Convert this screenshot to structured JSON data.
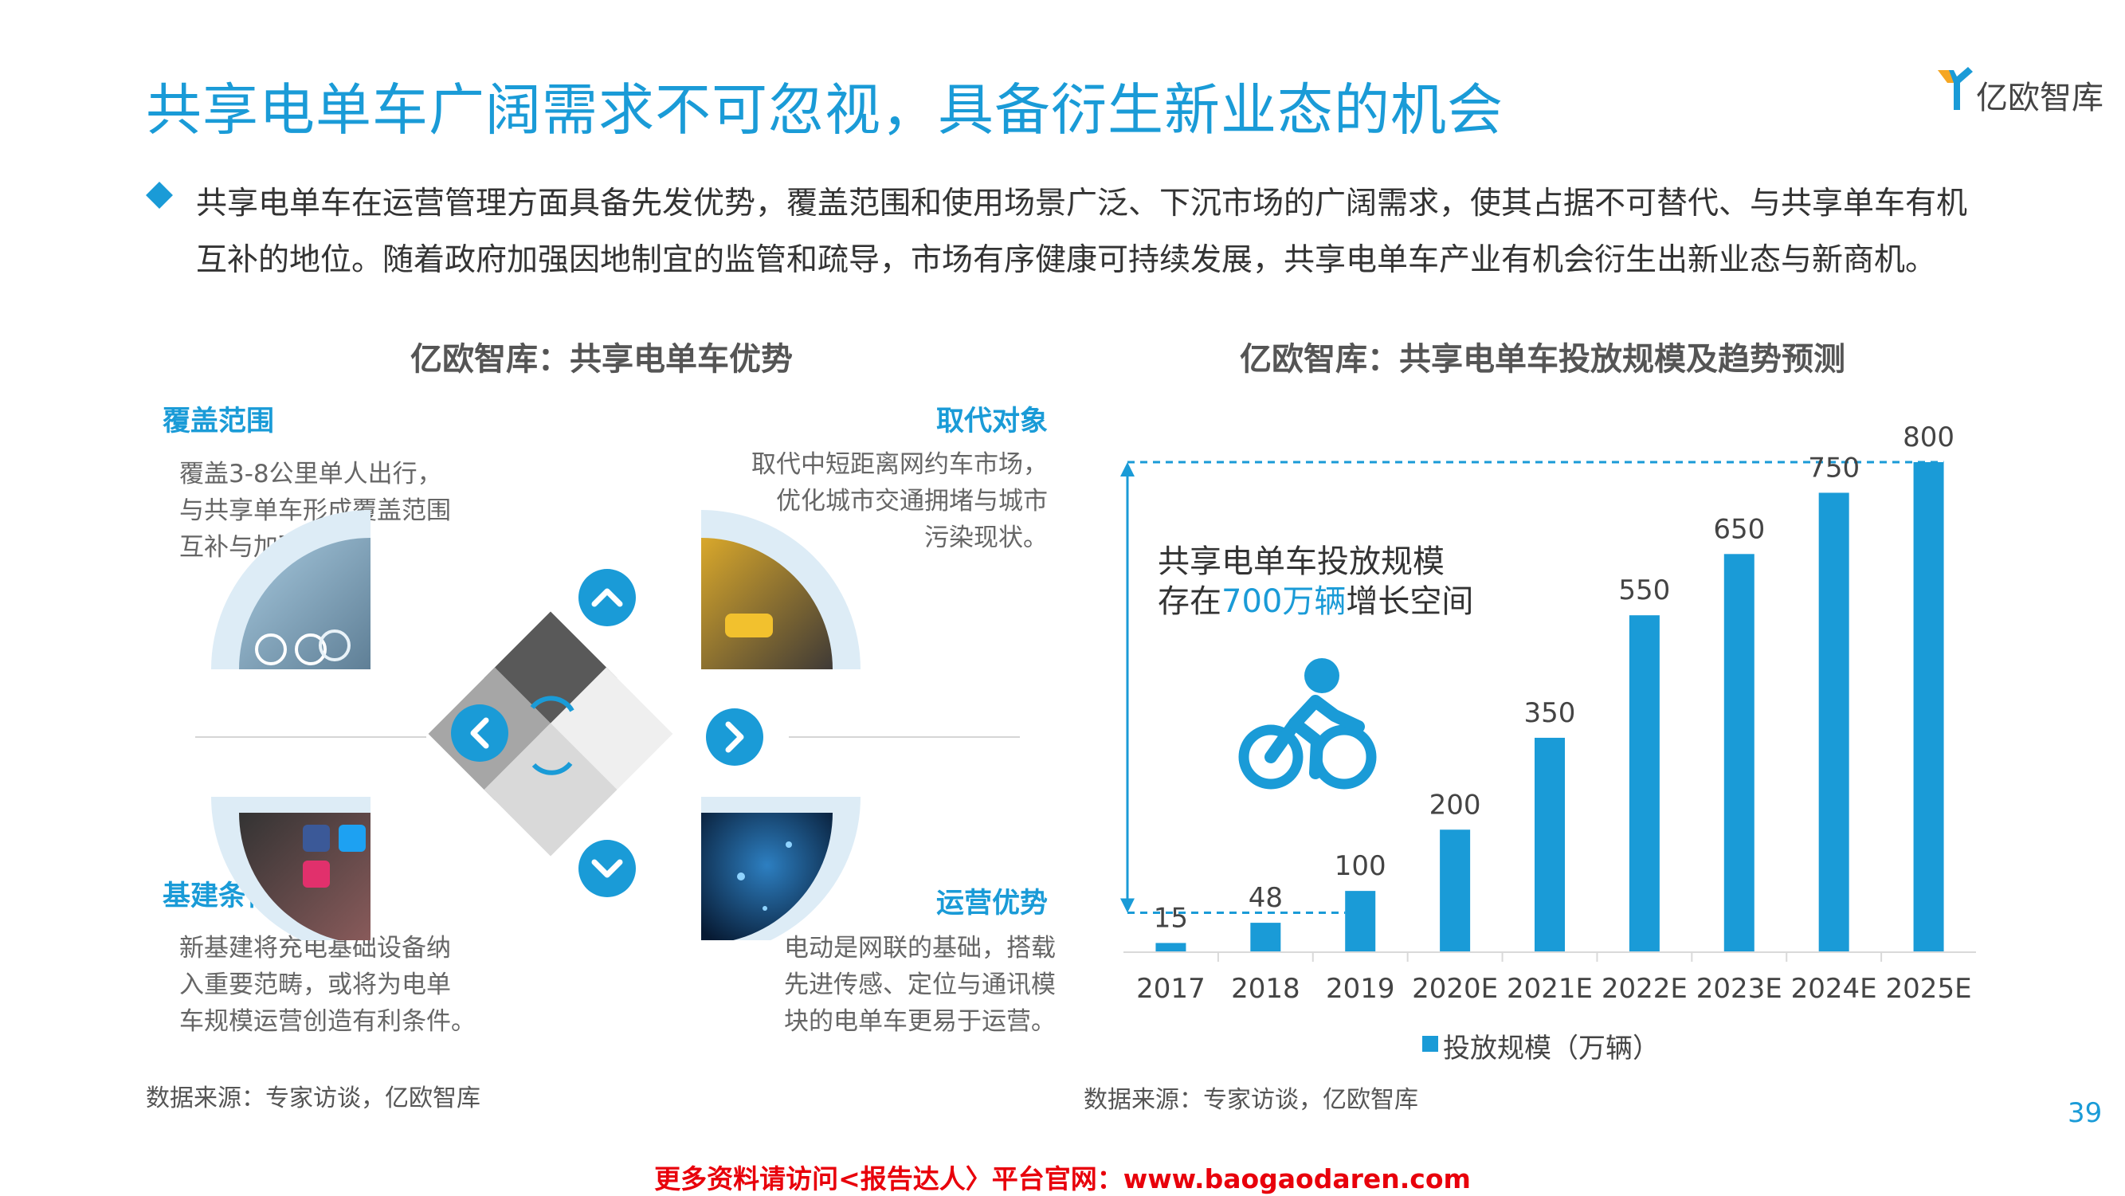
{
  "header": {
    "title": "共享电单车广阔需求不可忽视，具备衍生新业态的机会",
    "logo_text": "亿欧智库"
  },
  "bullet": {
    "line1": "共享电单车在运营管理方面具备先发优势，覆盖范围和使用场景广泛、下沉市场的广阔需求，使其占据不可替代、与共享单车有机",
    "line2": "互补的地位。随着政府加强因地制宜的监管和疏导，市场有序健康可持续发展，共享电单车产业有机会衍生出新业态与新商机。"
  },
  "left": {
    "title": "亿欧智库：共享电单车优势",
    "coverage": {
      "title": "覆盖范围",
      "lines": [
        "覆盖3-8公里单人出行，",
        "与共享单车形成覆盖范围",
        "互补与加强。"
      ]
    },
    "replace": {
      "title": "取代对象",
      "lines": [
        "取代中短距离网约车市场，",
        "优化城市交通拥堵与城市",
        "污染现状。"
      ]
    },
    "infra": {
      "title": "基建条件",
      "lines": [
        "新基建将充电基础设备纳",
        "入重要范畴，或将为电单",
        "车规模运营创造有利条件。"
      ]
    },
    "ops": {
      "title": "运营优势",
      "lines": [
        "电动是网联的基础，搭载",
        "先进传感、定位与通讯模",
        "块的电单车更易于运营。"
      ]
    },
    "source": "数据来源：专家访谈，亿欧智库"
  },
  "right": {
    "title": "亿欧智库：共享电单车投放规模及趋势预测",
    "annotation_line1": "共享电单车投放规模",
    "annotation_pre": "存在",
    "annotation_highlight": "700万辆",
    "annotation_post": "增长空间",
    "source": "数据来源：专家访谈，亿欧智库"
  },
  "chart_data": {
    "type": "bar",
    "categories": [
      "2017",
      "2018",
      "2019",
      "2020E",
      "2021E",
      "2022E",
      "2023E",
      "2024E",
      "2025E"
    ],
    "series": [
      {
        "name": "投放规模（万辆）",
        "values": [
          15,
          48,
          100,
          200,
          350,
          550,
          650,
          750,
          800
        ]
      }
    ],
    "ylim": [
      0,
      800
    ],
    "legend_position": "bottom",
    "bar_color": "#1a9bd7",
    "highlight_color": "#1a9bd7"
  },
  "footer": {
    "page_number": "39",
    "promo": "更多资料请访问<报告达人〉平台官网：www.baogaodaren.com"
  }
}
